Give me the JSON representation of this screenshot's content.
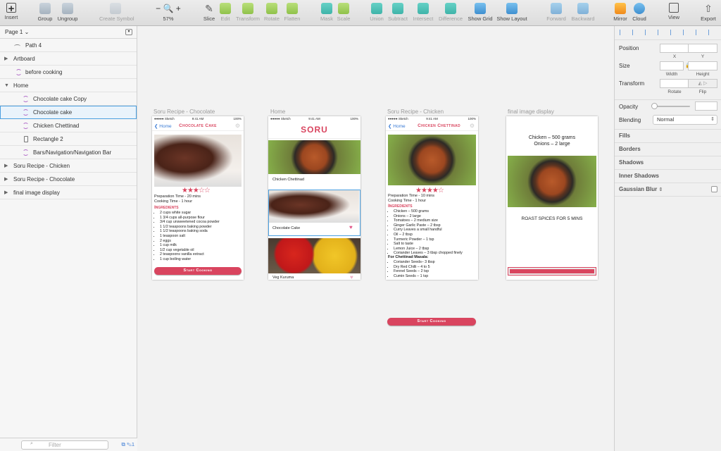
{
  "toolbar": {
    "insert": "Insert",
    "group": "Group",
    "ungroup": "Ungroup",
    "create_symbol": "Create Symbol",
    "zoom": "57%",
    "slice": "Slice",
    "edit": "Edit",
    "transform": "Transform",
    "rotate": "Rotate",
    "flatten": "Flatten",
    "mask": "Mask",
    "scale": "Scale",
    "union": "Union",
    "subtract": "Subtract",
    "intersect": "Intersect",
    "difference": "Difference",
    "show_grid": "Show Grid",
    "show_layout": "Show Layout",
    "forward": "Forward",
    "backward": "Backward",
    "mirror": "Mirror",
    "cloud": "Cloud",
    "view": "View",
    "export": "Export",
    "zoom_minus": "−",
    "zoom_plus": "+"
  },
  "layers": {
    "page": "Page 1",
    "items": [
      "Path 4",
      "Artboard",
      "before cooking",
      "Home",
      "Chocolate cake Copy",
      "Chocolate cake",
      "Chicken Chettinad",
      "Rectangle 2",
      "Bars/Navigation/Navigation Bar",
      "Soru Recipe - Chicken",
      "Soru Recipe - Chocolate",
      "final image display"
    ],
    "filter_placeholder": "Filter",
    "count": "1"
  },
  "artboards": {
    "chocolate": {
      "label": "Soru Recipe - Chocolate",
      "back": "Home",
      "title": "Chocolate Cake",
      "stars": "★★★☆☆",
      "prep": "Preparation Time - 20 mins",
      "cook": "Cooking Time - 1 hour",
      "ing_title": "Ingredients",
      "ingredients": [
        "2 cups white sugar",
        "1 3/4 cups all-purpose flour",
        "3/4 cup unsweetened cocoa powder",
        "1 1/2 teaspoons baking powder",
        "1 1/2 teaspoons baking soda",
        "1 teaspoon salt",
        "2 eggs",
        "1 cup milk",
        "1/2 cup vegetable oil",
        "2 teaspoons vanilla extract",
        "1 cup boiling water"
      ],
      "button": "Start Cooking"
    },
    "home": {
      "label": "Home",
      "title": "SORU",
      "card1": "Chicken Chettinad",
      "card2": "Chocolate Cake",
      "card3": "Veg Kuruma",
      "heart": "♥"
    },
    "chicken": {
      "label": "Soru Recipe - Chicken",
      "back": "Home",
      "title": "Chicken Chettinad",
      "stars": "★★★★☆",
      "prep": "Preparation Time - 10 mins",
      "cook": "Cooking Time - 1 hour",
      "ing_title": "Ingredients",
      "ingredients": [
        "Chicken – 500 grams",
        "Onions – 2 large",
        "Tomatoes – 2 medium size",
        "Ginger Garlic Paste – 2 tbsp",
        "Curry Leaves a small handful",
        "Oil – 2 tbsp",
        "Turmeric Powder – 1 tsp",
        "Salt to taste",
        "Lemon Juice – 2 tbsp",
        "Coriander Leaves – 3 tbsp chopped finely"
      ],
      "masala_title": "For Chettinad Masala:",
      "masala": [
        "Coriander Seeds– 3 tbsp",
        "Dry Red Chilli – 4 to 5",
        "Fennel Seeds – 2 tsp",
        "Cumin Seeds – 1 tsp"
      ],
      "button": "Start Cooking"
    },
    "final": {
      "label": "final image display",
      "line1": "Chicken – 500 grams",
      "line2": "Onions – 2 large",
      "instruction": "ROAST SPICES FOR 5 MINS"
    },
    "status": {
      "carrier": "●●●●● Sketch",
      "time": "9:41 AM",
      "battery": "100%"
    }
  },
  "inspector": {
    "position": "Position",
    "x": "X",
    "y": "Y",
    "size": "Size",
    "width": "Width",
    "height": "Height",
    "transform": "Transform",
    "rotate": "Rotate",
    "flip": "Flip",
    "opacity": "Opacity",
    "blending": "Blending",
    "blending_value": "Normal",
    "sections": [
      "Fills",
      "Borders",
      "Shadows",
      "Inner Shadows",
      "Gaussian Blur"
    ]
  },
  "colors": {
    "accent": "#d9455f",
    "selection": "#4a9fe0"
  }
}
